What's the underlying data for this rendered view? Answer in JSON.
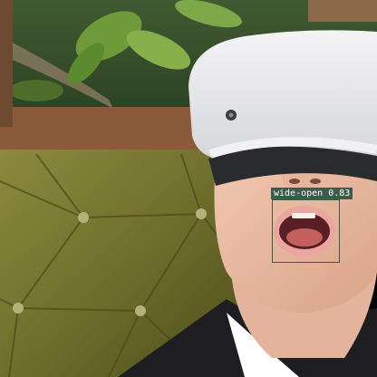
{
  "detection": {
    "label": "wide-open",
    "score": "0.83",
    "color": "#3e5b4a"
  }
}
